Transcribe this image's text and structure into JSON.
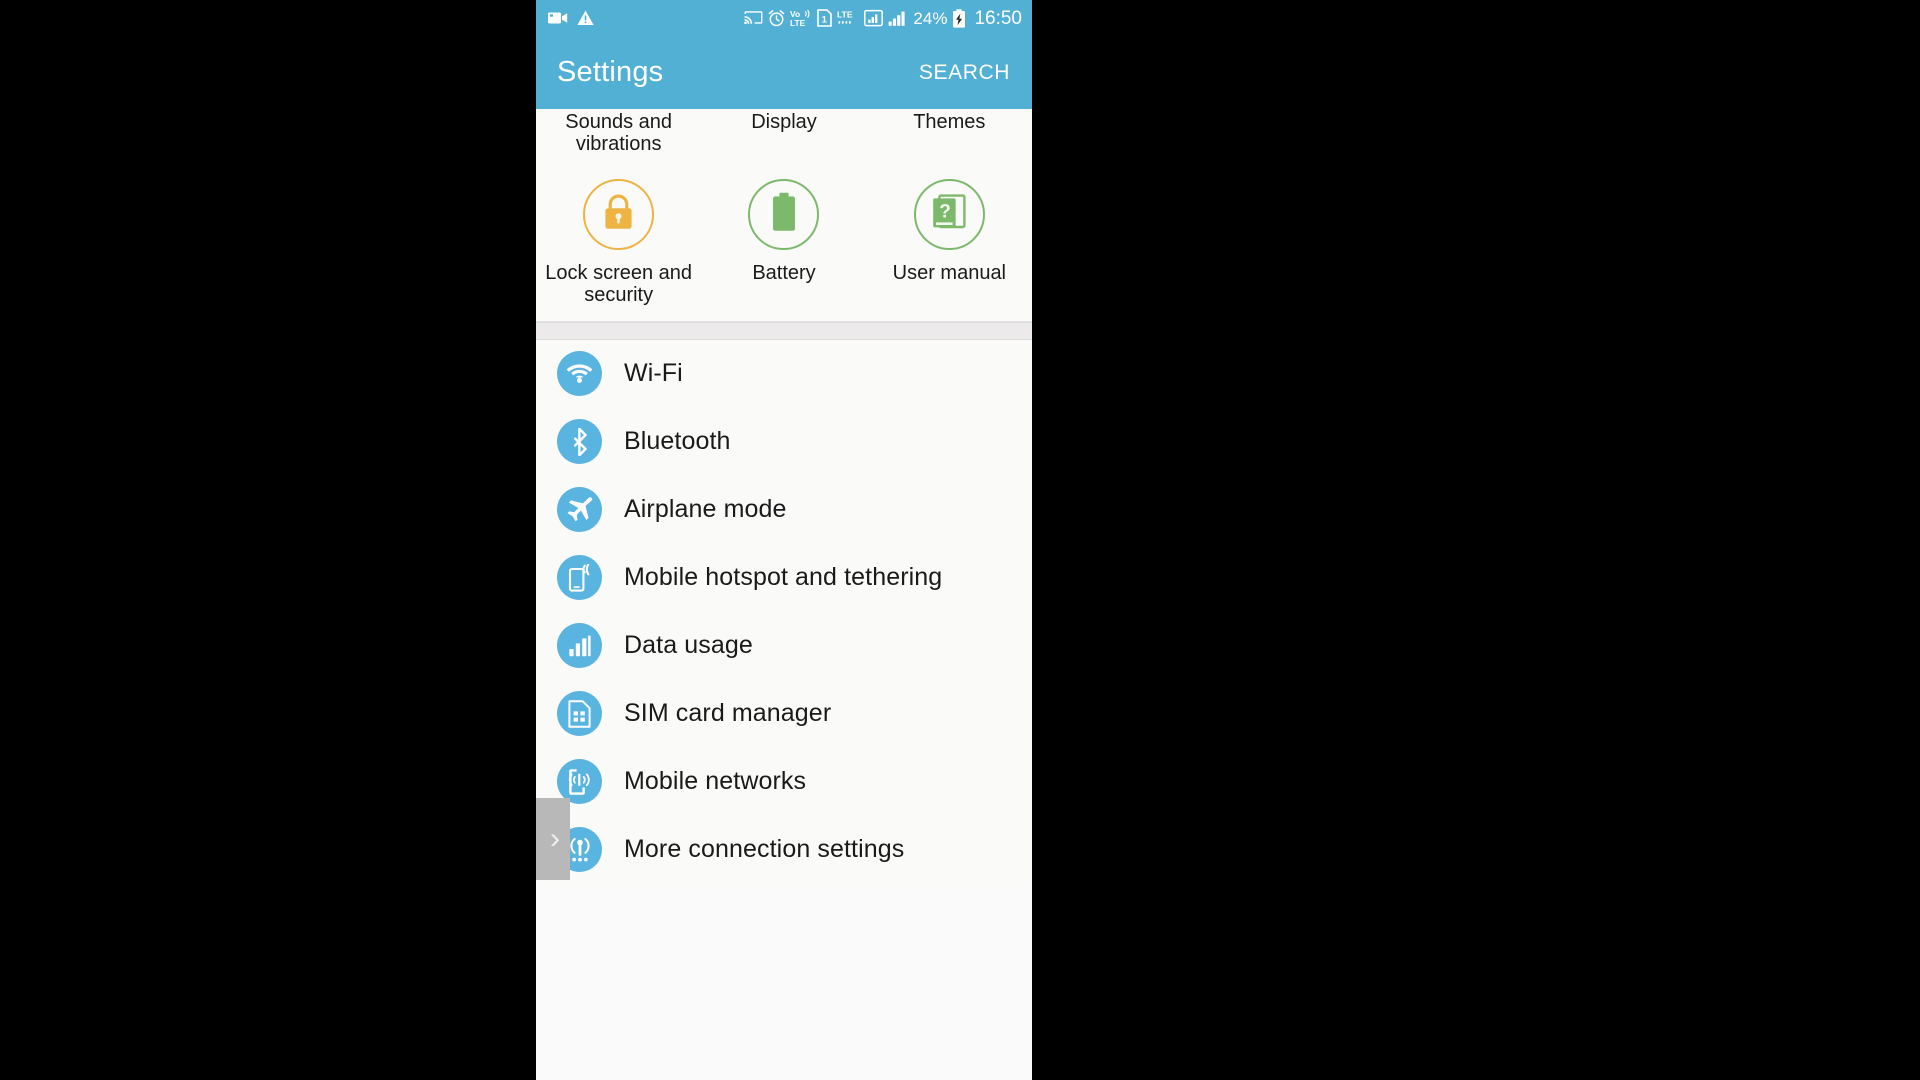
{
  "status_bar": {
    "left_icons": [
      {
        "name": "screen-recorder-icon",
        "glyph": "videocam"
      },
      {
        "name": "warning-triangle-icon",
        "glyph": "warning"
      }
    ],
    "right_icons": [
      {
        "name": "screen-cast-icon",
        "glyph": "cast"
      },
      {
        "name": "alarm-clock-icon",
        "glyph": "alarm"
      },
      {
        "name": "volte-icon",
        "glyph": "volte",
        "label_top": "Vo))",
        "label_bottom": "LTE"
      },
      {
        "name": "sim-slot-1-icon",
        "glyph": "sim1",
        "label": "1"
      },
      {
        "name": "lte-network-icon",
        "glyph": "lte",
        "label": "LTE"
      },
      {
        "name": "signal-bars-sim1-icon",
        "glyph": "signal-boxed"
      },
      {
        "name": "signal-bars-sim2-icon",
        "glyph": "signal"
      }
    ],
    "battery_percent": "24%",
    "battery_state": "charging",
    "time": "16:50"
  },
  "app_bar": {
    "title": "Settings",
    "search_label": "SEARCH"
  },
  "quick_grid": {
    "top_row": [
      {
        "label": "Sounds and vibrations",
        "name": "quick-sounds-and-vibrations"
      },
      {
        "label": "Display",
        "name": "quick-display"
      },
      {
        "label": "Themes",
        "name": "quick-themes"
      }
    ],
    "bottom_row": [
      {
        "label": "Lock screen and security",
        "name": "quick-lock-screen-and-security",
        "icon": "lock-icon",
        "accent": "#eeb443"
      },
      {
        "label": "Battery",
        "name": "quick-battery",
        "icon": "battery-icon",
        "accent": "#7cb96a"
      },
      {
        "label": "User manual",
        "name": "quick-user-manual",
        "icon": "manual-question-icon",
        "accent": "#7cb96a"
      }
    ]
  },
  "settings_list": {
    "items": [
      {
        "label": "Wi-Fi",
        "icon": "wifi-icon"
      },
      {
        "label": "Bluetooth",
        "icon": "bluetooth-icon"
      },
      {
        "label": "Airplane mode",
        "icon": "airplane-icon"
      },
      {
        "label": "Mobile hotspot and tethering",
        "icon": "hotspot-icon"
      },
      {
        "label": "Data usage",
        "icon": "data-usage-icon"
      },
      {
        "label": "SIM card manager",
        "icon": "sim-card-icon"
      },
      {
        "label": "Mobile networks",
        "icon": "mobile-networks-icon"
      },
      {
        "label": "More connection settings",
        "icon": "more-connections-icon"
      }
    ]
  },
  "edge_panel": {
    "handle_glyph": "›"
  },
  "colors": {
    "header_blue": "#53b0d5",
    "list_icon_blue": "#5ab4e0",
    "lock_orange": "#eeb443",
    "battery_green": "#7cb96a",
    "page_background": "#fafaf9",
    "letterbox": "#000000"
  }
}
